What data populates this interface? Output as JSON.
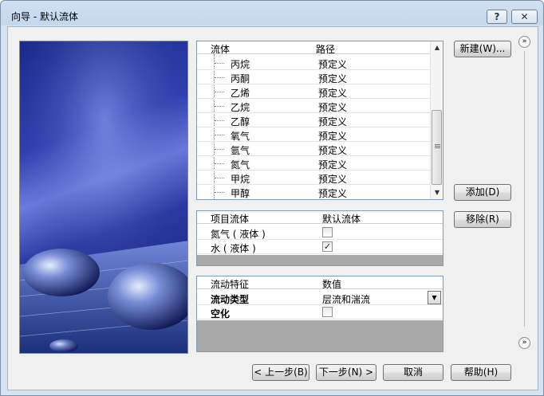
{
  "window": {
    "title": "向导 - 默认流体",
    "help_btn": "?",
    "close_btn": "✕"
  },
  "fluid_table": {
    "col_fluid": "流体",
    "col_path": "路径",
    "rows": [
      {
        "name": "丙烷",
        "path": "预定义"
      },
      {
        "name": "丙酮",
        "path": "预定义"
      },
      {
        "name": "乙烯",
        "path": "预定义"
      },
      {
        "name": "乙烷",
        "path": "预定义"
      },
      {
        "name": "乙醇",
        "path": "预定义"
      },
      {
        "name": "氧气",
        "path": "预定义"
      },
      {
        "name": "氩气",
        "path": "预定义"
      },
      {
        "name": "氮气",
        "path": "预定义"
      },
      {
        "name": "甲烷",
        "path": "预定义"
      },
      {
        "name": "甲醇",
        "path": "预定义"
      }
    ]
  },
  "project_fluids": {
    "col_fluid": "项目流体",
    "col_default": "默认流体",
    "rows": [
      {
        "name": "氮气 ( 液体 )",
        "checked": false,
        "mark": ""
      },
      {
        "name": "水 ( 液体 )",
        "checked": true,
        "mark": "✓"
      }
    ]
  },
  "flow_props": {
    "col_feature": "流动特征",
    "col_value": "数值",
    "rows": [
      {
        "name": "流动类型",
        "value": "层流和湍流"
      },
      {
        "name": "空化",
        "value": ""
      }
    ],
    "cavitation_mark": ""
  },
  "side_buttons": {
    "new": "新建(W)...",
    "add": "添加(D)",
    "remove": "移除(R)"
  },
  "nav_buttons": {
    "back": "< 上一步(B)",
    "next": "下一步(N) >",
    "cancel": "取消",
    "help": "帮助(H)"
  },
  "icons": {
    "expand_top": "»",
    "expand_bottom": "»",
    "scroll_up": "▲",
    "scroll_down": "▼",
    "combo_down": "▼"
  }
}
